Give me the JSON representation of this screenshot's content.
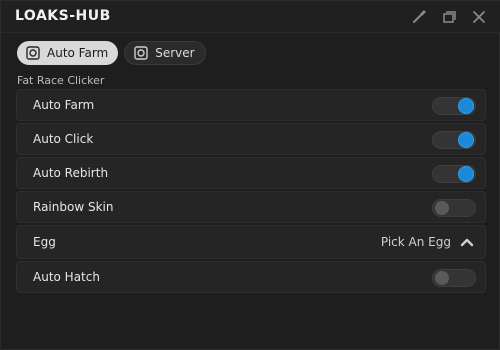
{
  "window": {
    "title": "LOAKS-HUB"
  },
  "tabs": [
    {
      "label": "Auto Farm",
      "active": true
    },
    {
      "label": "Server",
      "active": false
    }
  ],
  "section": {
    "label": "Fat Race Clicker"
  },
  "rows": [
    {
      "label": "Auto Farm",
      "type": "toggle",
      "on": true
    },
    {
      "label": "Auto Click",
      "type": "toggle",
      "on": true
    },
    {
      "label": "Auto Rebirth",
      "type": "toggle",
      "on": true
    },
    {
      "label": "Rainbow Skin",
      "type": "toggle",
      "on": false
    },
    {
      "label": "Egg",
      "type": "dropdown",
      "value": "Pick An Egg"
    },
    {
      "label": "Auto Hatch",
      "type": "toggle",
      "on": false
    }
  ],
  "colors": {
    "accent": "#1e88d8",
    "background": "#1e1e1e",
    "row": "#252525"
  }
}
